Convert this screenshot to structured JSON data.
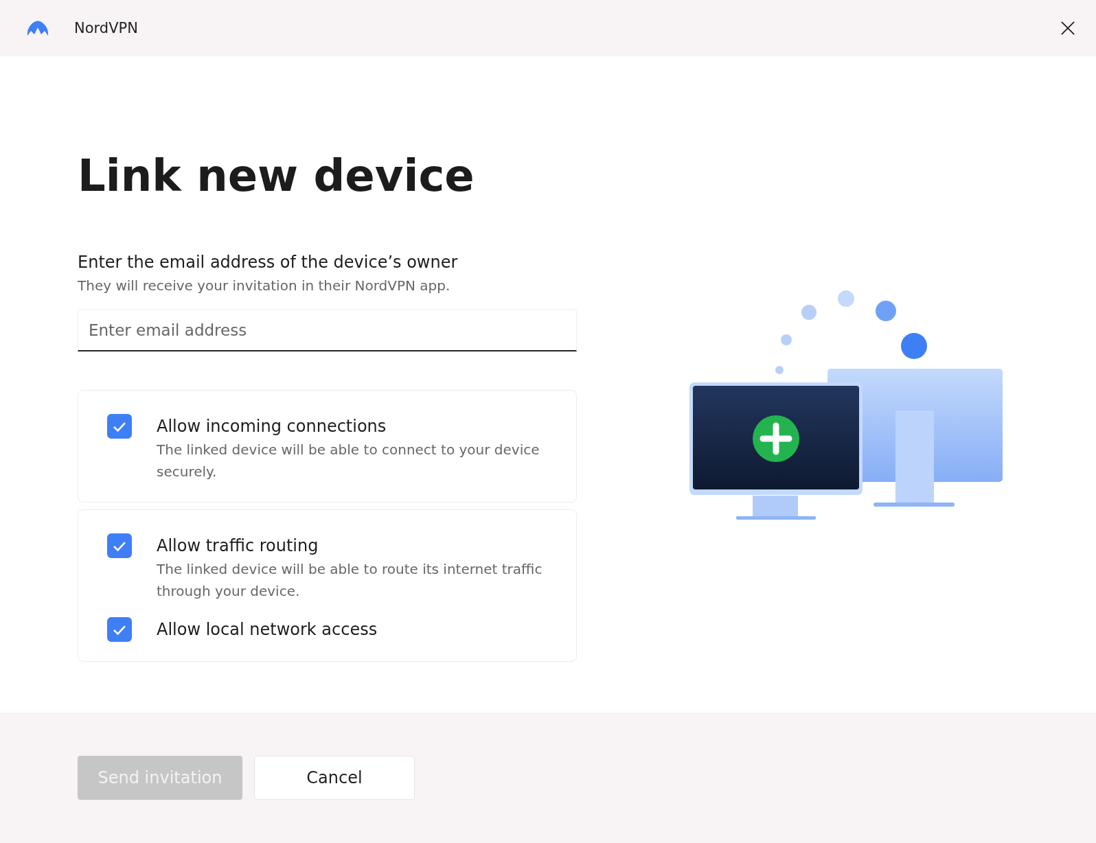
{
  "window": {
    "title": "NordVPN"
  },
  "heading": "Link new device",
  "prompt": "Enter the email address of the device’s owner",
  "hint": "They will receive your invitation in their NordVPN app.",
  "email": {
    "placeholder": "Enter email address"
  },
  "permission_groups": [
    {
      "options": [
        {
          "label": "Allow incoming connections",
          "description": "The linked device will be able to connect to your device securely.",
          "checked": true
        }
      ]
    },
    {
      "options": [
        {
          "label": "Allow traffic routing",
          "description": "The linked device will be able to route its internet traffic through your device.",
          "checked": true
        },
        {
          "label": "Allow local network access",
          "checked": true
        }
      ]
    }
  ],
  "buttons": [
    {
      "label": "Send invitation",
      "kind": "primary",
      "disabled": true
    },
    {
      "label": "Cancel",
      "kind": "secondary",
      "disabled": false
    }
  ]
}
